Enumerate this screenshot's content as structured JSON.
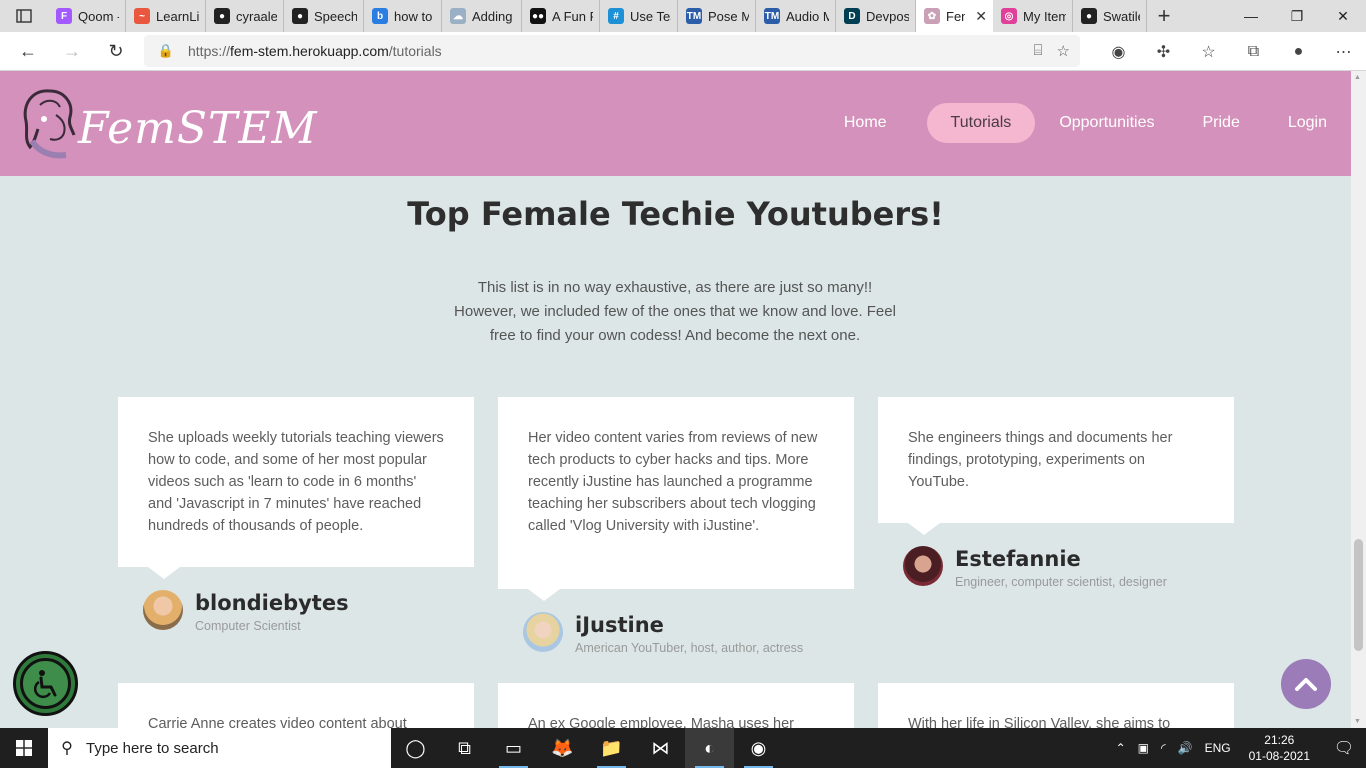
{
  "browser": {
    "tabs": [
      {
        "title": "Qoom -",
        "color": "#a259ff",
        "glyph": "F"
      },
      {
        "title": "LearnLi",
        "color": "#e9573f",
        "glyph": "~"
      },
      {
        "title": "cyraale",
        "color": "#222222",
        "glyph": "●"
      },
      {
        "title": "Speech",
        "color": "#222222",
        "glyph": "●"
      },
      {
        "title": "how to",
        "color": "#2a7de1",
        "glyph": "b"
      },
      {
        "title": "Adding",
        "color": "#9ab0c4",
        "glyph": "☁"
      },
      {
        "title": "A Fun P",
        "color": "#111111",
        "glyph": "●●"
      },
      {
        "title": "Use Tea",
        "color": "#1e90d6",
        "glyph": "#"
      },
      {
        "title": "Pose M",
        "color": "#2b5da8",
        "glyph": "TM"
      },
      {
        "title": "Audio M",
        "color": "#2b5da8",
        "glyph": "TM"
      },
      {
        "title": "Devpost",
        "color": "#003e54",
        "glyph": "D"
      },
      {
        "title": "Fen",
        "color": "#c9a0b5",
        "glyph": "✿",
        "active": true,
        "close": "✕"
      },
      {
        "title": "My Item",
        "color": "#e0409a",
        "glyph": "◎"
      },
      {
        "title": "Swatilek",
        "color": "#222222",
        "glyph": "●"
      }
    ],
    "new_tab": "+",
    "window_controls": {
      "minimize": "—",
      "maximize": "❐",
      "close": "✕"
    },
    "back": "←",
    "forward": "→",
    "reload": "↻",
    "url_prefix": "https://",
    "url_host": "fem-stem.herokuapp.com",
    "url_path": "/tutorials",
    "lock": "🔒",
    "reader": "⌸",
    "favorite_add": "☆",
    "toolbar": [
      "◉",
      "✣",
      "☆",
      "⧉",
      "●",
      "⋯"
    ]
  },
  "site": {
    "logo_text": "FemSTEM",
    "nav": [
      "Home",
      "Tutorials",
      "Opportunities",
      "Pride",
      "Login"
    ],
    "nav_active": "Tutorials",
    "colors": {
      "header": "#d491bb",
      "active_pill": "#f5b6d0",
      "background": "#dce6e6",
      "to_top": "#9b7bb8"
    },
    "title": "Top Female Techie Youtubers!",
    "intro_lines": [
      "This list is in no way exhaustive, as there are just so many!!",
      "However, we included few of the ones that we know and love. Feel",
      "free to find your own codess! And become the next one."
    ],
    "cards": [
      {
        "text": "She uploads weekly tutorials teaching viewers how to code, and some of her most popular videos such as 'learn to code in 6 months' and 'Javascript in 7 minutes' have reached hundreds of thousands of people.",
        "name": "blondiebytes",
        "role": "Computer Scientist",
        "avatar": "#e8c08f"
      },
      {
        "text": "Her video content varies from reviews of new tech products to cyber hacks and tips. More recently iJustine has launched a programme teaching her subscribers about tech vlogging called 'Vlog University with iJustine'.",
        "name": "iJustine",
        "role": "American YouTuber, host, author, actress",
        "avatar": "#b9d2e6"
      },
      {
        "text": "She engineers things and documents her findings, prototyping, experiments on YouTube.",
        "name": "Estefannie",
        "role": "Engineer, computer scientist, designer",
        "avatar": "#8a2f3a"
      }
    ],
    "cards_row2": [
      "Carrie Anne creates video content about",
      "An ex Google employee, Masha uses her",
      "With her life in Silicon Valley, she aims to"
    ]
  },
  "taskbar": {
    "search_placeholder": "Type here to search",
    "apps": [
      "◯",
      "⧉",
      "▭",
      "🦊",
      "📁",
      "⋈",
      "◐",
      "◉"
    ],
    "tray": [
      "⌃",
      "▣",
      "◜",
      "🔊"
    ],
    "lang": "ENG",
    "time": "21:26",
    "date": "01-08-2021",
    "notification": "🗨"
  }
}
